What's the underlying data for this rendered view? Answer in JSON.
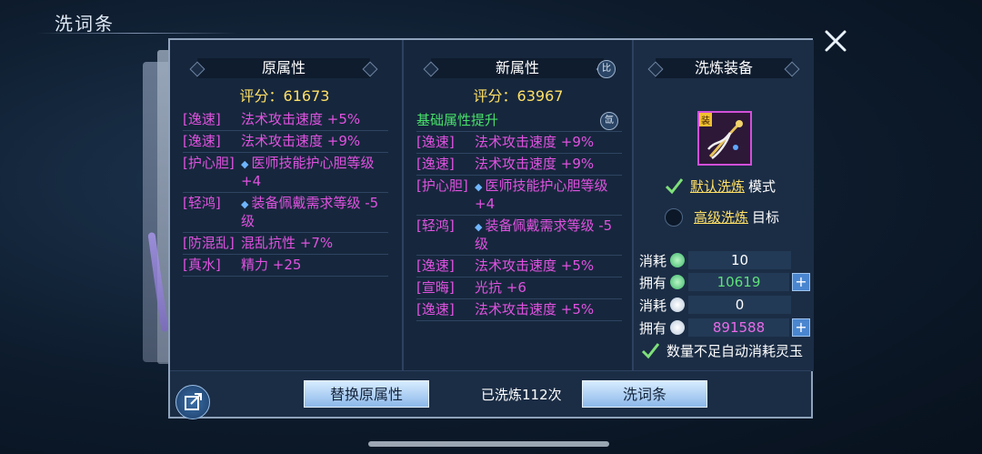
{
  "window": {
    "title": "洗词条"
  },
  "original": {
    "header": "原属性",
    "score": "评分：61673",
    "rows": [
      {
        "tag": "[逸速]",
        "text": "法术攻击速度 +5%",
        "dot": false
      },
      {
        "tag": "[逸速]",
        "text": "法术攻击速度 +9%",
        "dot": false
      },
      {
        "tag": "[护心胆]",
        "text": "医师技能护心胆等级+4",
        "dot": true
      },
      {
        "tag": "[轻鸿]",
        "text": "装备佩戴需求等级 -5级",
        "dot": true
      },
      {
        "tag": "[防混乱]",
        "text": "混乱抗性 +7%",
        "dot": false
      },
      {
        "tag": "[真水]",
        "text": "精力 +25",
        "dot": false
      }
    ]
  },
  "new_attr": {
    "header": "新属性",
    "header_badge": "比",
    "score": "评分：63967",
    "section": "基础属性提升",
    "section_badge": "氙",
    "rows": [
      {
        "tag": "[逸速]",
        "text": "法术攻击速度 +9%",
        "dot": false
      },
      {
        "tag": "[逸速]",
        "text": "法术攻击速度 +9%",
        "dot": false
      },
      {
        "tag": "[护心胆]",
        "text": "医师技能护心胆等级+4",
        "dot": true
      },
      {
        "tag": "[轻鸿]",
        "text": "装备佩戴需求等级 -5级",
        "dot": true
      },
      {
        "tag": "[逸速]",
        "text": "法术攻击速度 +5%",
        "dot": false
      },
      {
        "tag": "[宣晦]",
        "text": "光抗 +6",
        "dot": false
      },
      {
        "tag": "[逸速]",
        "text": "法术攻击速度 +5%",
        "dot": false
      }
    ]
  },
  "wash": {
    "header": "洗炼装备",
    "item_tag": "装",
    "default_mode": {
      "link": "默认洗炼",
      "suffix": "模式",
      "checked": true
    },
    "advanced_mode": {
      "link": "高级洗炼",
      "suffix": "目标",
      "checked": false
    },
    "resources": [
      {
        "label": "消耗",
        "value": "10",
        "value_color": "#ffffff",
        "icon": "jade-coin-icon",
        "plus": false
      },
      {
        "label": "拥有",
        "value": "10619",
        "value_color": "#5ee07a",
        "icon": "jade-coin-icon",
        "plus": true
      },
      {
        "label": "消耗",
        "value": "0",
        "value_color": "#ffffff",
        "icon": "spirit-jade-icon",
        "plus": false
      },
      {
        "label": "拥有",
        "value": "891588",
        "value_color": "#e96be9",
        "icon": "spirit-jade-icon",
        "plus": true
      }
    ],
    "auto_consume": {
      "label": "数量不足自动消耗灵玉",
      "checked": true
    }
  },
  "footer": {
    "replace_button": "替换原属性",
    "wash_count": "已洗炼112次",
    "wash_button": "洗词条"
  },
  "colors": {
    "attr_text": "#e052e0",
    "score": "#ffe066",
    "section": "#48e06a",
    "link": "#ffe066"
  }
}
